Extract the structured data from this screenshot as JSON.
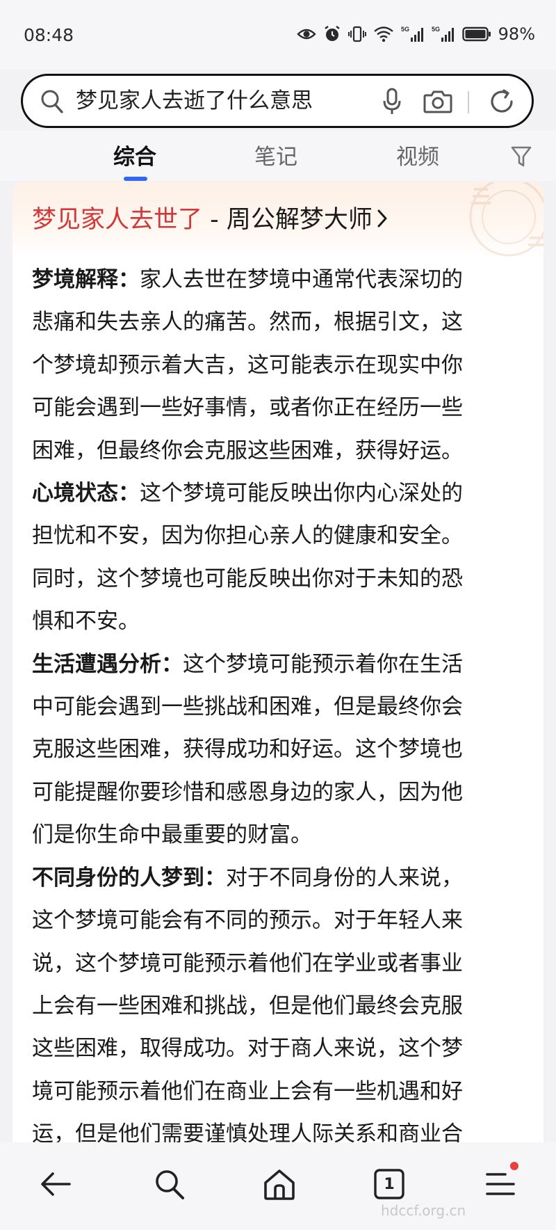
{
  "status_bar": {
    "time": "08:48",
    "battery": "98%",
    "icons": [
      "eye-icon",
      "alarm-icon",
      "vibrate-icon",
      "wifi-icon",
      "signal-5g-icon",
      "signal-5g-icon",
      "battery-icon"
    ]
  },
  "search": {
    "query": "梦见家人去逝了什么意思",
    "icons": [
      "search-icon",
      "mic-icon",
      "camera-icon",
      "refresh-icon"
    ]
  },
  "tabs": [
    {
      "label": "综合",
      "active": true
    },
    {
      "label": "笔记",
      "active": false
    },
    {
      "label": "视频",
      "active": false
    }
  ],
  "card": {
    "title_highlight": "梦见家人去世了",
    "title_rest": " - 周公解梦大师",
    "lines": [
      {
        "label": "梦境解释：",
        "text": "家人去世在梦境中通常代表深切的"
      },
      {
        "label": "",
        "text": "悲痛和失去亲人的痛苦。然而，根据引文，这"
      },
      {
        "label": "",
        "text": "个梦境却预示着大吉，这可能表示在现实中你"
      },
      {
        "label": "",
        "text": "可能会遇到一些好事情，或者你正在经历一些"
      },
      {
        "label": "",
        "text": "困难，但最终你会克服这些困难，获得好运。"
      },
      {
        "label": "心境状态：",
        "text": "这个梦境可能反映出你内心深处的"
      },
      {
        "label": "",
        "text": "担忧和不安，因为你担心亲人的健康和安全。"
      },
      {
        "label": "",
        "text": "同时，这个梦境也可能反映出你对于未知的恐"
      },
      {
        "label": "",
        "text": "惧和不安。"
      },
      {
        "label": "生活遭遇分析：",
        "text": "这个梦境可能预示着你在生活"
      },
      {
        "label": "",
        "text": "中可能会遇到一些挑战和困难，但是最终你会"
      },
      {
        "label": "",
        "text": "克服这些困难，获得成功和好运。这个梦境也"
      },
      {
        "label": "",
        "text": "可能提醒你要珍惜和感恩身边的家人，因为他"
      },
      {
        "label": "",
        "text": "们是你生命中最重要的财富。"
      },
      {
        "label": "不同身份的人梦到：",
        "text": "对于不同身份的人来说，"
      },
      {
        "label": "",
        "text": "这个梦境可能会有不同的预示。对于年轻人来"
      },
      {
        "label": "",
        "text": "说，这个梦境可能预示着他们在学业或者事业"
      },
      {
        "label": "",
        "text": "上会有一些困难和挑战，但是他们最终会克服"
      },
      {
        "label": "",
        "text": "这些困难，取得成功。对于商人来说，这个梦"
      },
      {
        "label": "",
        "text": "境可能预示着他们在商业上会有一些机遇和好"
      },
      {
        "label": "",
        "text": "运，但是他们需要谨慎处理人际关系和商业合"
      }
    ]
  },
  "bottom_nav": {
    "tab_count": "1",
    "icons": [
      "back-arrow-icon",
      "search-icon",
      "home-icon",
      "tabs-icon",
      "menu-icon"
    ]
  },
  "watermark": "hdccf.org.cn",
  "colors": {
    "accent": "#3167f5",
    "title_red": "#d23838",
    "notify_dot": "#e8403c"
  }
}
